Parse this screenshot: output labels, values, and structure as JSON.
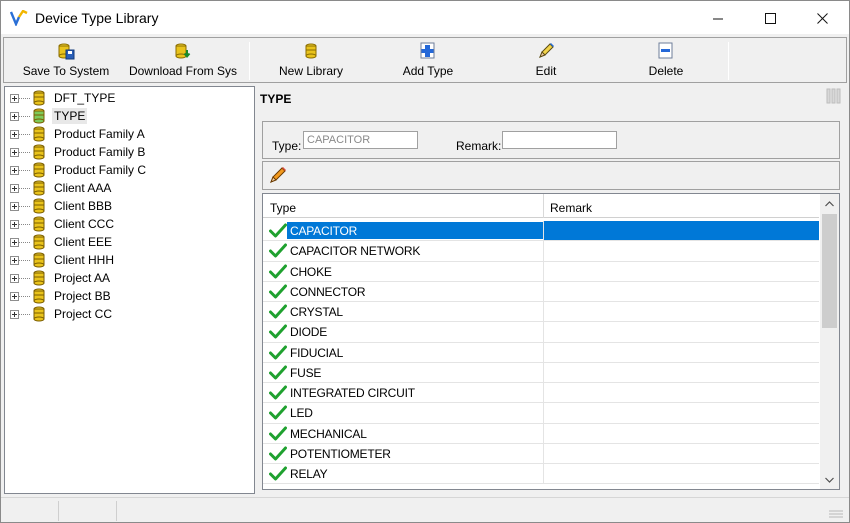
{
  "window": {
    "title": "Device Type Library",
    "minimize": "—",
    "maximize": "☐",
    "close": "✕"
  },
  "toolbar": {
    "buttons": [
      {
        "label": "Save To System",
        "icon": "save-database-icon"
      },
      {
        "label": "Download From Sys",
        "icon": "download-database-icon"
      },
      {
        "label": "New Library",
        "icon": "database-icon"
      },
      {
        "label": "Add Type",
        "icon": "add-icon"
      },
      {
        "label": "Edit",
        "icon": "edit-icon"
      },
      {
        "label": "Delete",
        "icon": "delete-icon"
      }
    ]
  },
  "tree": {
    "items": [
      {
        "label": "DFT_TYPE",
        "selected": false
      },
      {
        "label": "TYPE",
        "selected": true
      },
      {
        "label": "Product Family A",
        "selected": false
      },
      {
        "label": "Product Family B",
        "selected": false
      },
      {
        "label": "Product Family C",
        "selected": false
      },
      {
        "label": "Client AAA",
        "selected": false
      },
      {
        "label": "Client BBB",
        "selected": false
      },
      {
        "label": "Client CCC",
        "selected": false
      },
      {
        "label": "Client EEE",
        "selected": false
      },
      {
        "label": "Client HHH",
        "selected": false
      },
      {
        "label": "Project AA",
        "selected": false
      },
      {
        "label": "Project BB",
        "selected": false
      },
      {
        "label": "Project CC",
        "selected": false
      }
    ]
  },
  "detail": {
    "title": "TYPE",
    "type_label": "Type:",
    "type_value": "CAPACITOR",
    "remark_label": "Remark:",
    "remark_value": ""
  },
  "grid": {
    "columns": [
      "Type",
      "Remark"
    ],
    "rows": [
      {
        "type": "CAPACITOR",
        "remark": "",
        "selected": true
      },
      {
        "type": "CAPACITOR NETWORK",
        "remark": ""
      },
      {
        "type": "CHOKE",
        "remark": ""
      },
      {
        "type": "CONNECTOR",
        "remark": ""
      },
      {
        "type": "CRYSTAL",
        "remark": ""
      },
      {
        "type": "DIODE",
        "remark": ""
      },
      {
        "type": "FIDUCIAL",
        "remark": ""
      },
      {
        "type": "FUSE",
        "remark": ""
      },
      {
        "type": "INTEGRATED CIRCUIT",
        "remark": ""
      },
      {
        "type": "LED",
        "remark": ""
      },
      {
        "type": "MECHANICAL",
        "remark": ""
      },
      {
        "type": "POTENTIOMETER",
        "remark": ""
      },
      {
        "type": "RELAY",
        "remark": ""
      }
    ],
    "scroll_up": "⌃",
    "scroll_down": "⌄"
  },
  "colors": {
    "selection": "#0078d7",
    "check_green": "#1fa12f",
    "db_yellow": "#e9c31b"
  }
}
